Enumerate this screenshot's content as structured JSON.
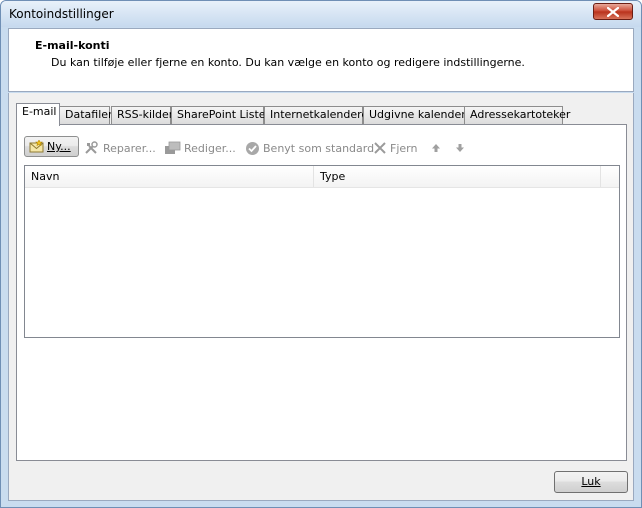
{
  "window": {
    "title": "Kontoindstillinger"
  },
  "header": {
    "title": "E-mail-konti",
    "description": "Du kan tilføje eller fjerne en konto. Du kan vælge en konto og redigere indstillingerne."
  },
  "tabs": [
    {
      "label": "E-mail",
      "active": true
    },
    {
      "label": "Datafiler"
    },
    {
      "label": "RSS-kilder"
    },
    {
      "label": "SharePoint Lister"
    },
    {
      "label": "Internetkalendere"
    },
    {
      "label": "Udgivne kalendere"
    },
    {
      "label": "Adressekartoteker"
    }
  ],
  "toolbar": {
    "new_label": "Ny...",
    "repair_label": "Reparer...",
    "edit_label": "Rediger...",
    "default_label": "Benyt som standard",
    "remove_label": "Fjern"
  },
  "list": {
    "columns": [
      "Navn",
      "Type"
    ],
    "rows": []
  },
  "footer": {
    "close_label": "Luk"
  }
}
